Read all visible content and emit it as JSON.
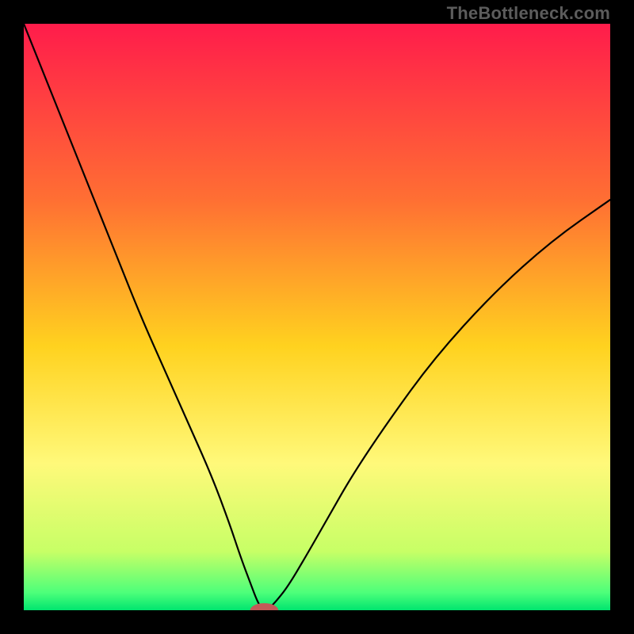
{
  "watermark": "TheBottleneck.com",
  "chart_data": {
    "type": "line",
    "title": "",
    "xlabel": "",
    "ylabel": "",
    "xlim": [
      0,
      100
    ],
    "ylim": [
      0,
      100
    ],
    "grid": false,
    "legend": false,
    "gradient_stops": [
      {
        "offset": 0,
        "color": "#ff1c4b"
      },
      {
        "offset": 30,
        "color": "#ff6f33"
      },
      {
        "offset": 55,
        "color": "#ffd21f"
      },
      {
        "offset": 75,
        "color": "#fff97a"
      },
      {
        "offset": 90,
        "color": "#c7ff66"
      },
      {
        "offset": 97,
        "color": "#4dff7a"
      },
      {
        "offset": 100,
        "color": "#00e56f"
      }
    ],
    "series": [
      {
        "name": "bottleneck-curve",
        "color": "#000000",
        "x": [
          0,
          4,
          8,
          12,
          16,
          20,
          24,
          28,
          32,
          35,
          37,
          38.5,
          40,
          41,
          42,
          43,
          45,
          48,
          52,
          56,
          62,
          70,
          80,
          90,
          100
        ],
        "y": [
          100,
          90,
          80,
          70,
          60,
          50,
          41,
          32,
          23,
          15,
          9,
          5,
          1,
          0,
          0.5,
          1.5,
          4,
          9,
          16,
          23,
          32,
          43,
          54,
          63,
          70
        ]
      }
    ],
    "marker": {
      "name": "optimal-point",
      "x": 41,
      "y": 0,
      "rx": 2.4,
      "ry": 1.2,
      "color": "#c25a58"
    }
  }
}
